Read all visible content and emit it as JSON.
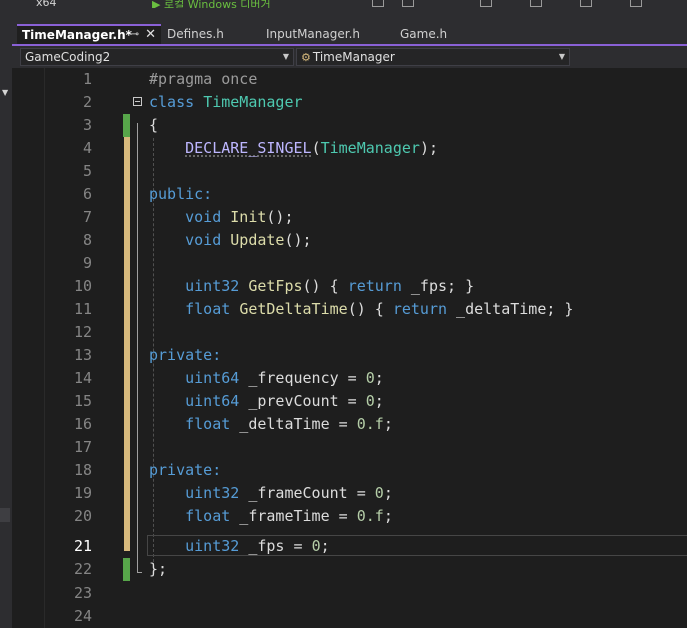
{
  "toolbar": {
    "platform_label": "x64",
    "run_label": "▶ 로컬 Windows 디버거"
  },
  "tabs": [
    {
      "label": "TimeManager.h*",
      "active": true
    },
    {
      "label": "Defines.h",
      "active": false
    },
    {
      "label": "InputManager.h",
      "active": false
    },
    {
      "label": "Game.h",
      "active": false
    }
  ],
  "tab_icons": {
    "pin": "⊸",
    "close": "✕"
  },
  "navigation": {
    "project": "GameCoding2",
    "scope": "TimeManager",
    "scope_icon": "class-icon"
  },
  "colors": {
    "accent": "#8a61d6",
    "keyword": "#569cd6",
    "type": "#4ec9b0",
    "function": "#dcdcaa",
    "number": "#b5cea8",
    "saved_change": "#57a64a",
    "unsaved_change": "#d7ba7d"
  },
  "editor": {
    "current_line": 21,
    "lines": [
      {
        "n": "1",
        "text": "#pragma once"
      },
      {
        "n": "2",
        "text": "class TimeManager"
      },
      {
        "n": "3",
        "text": "{"
      },
      {
        "n": "4",
        "text": "DECLARE_SINGEL(TimeManager);"
      },
      {
        "n": "5",
        "text": ""
      },
      {
        "n": "6",
        "text": "public:"
      },
      {
        "n": "7",
        "text": "void Init();"
      },
      {
        "n": "8",
        "text": "void Update();"
      },
      {
        "n": "9",
        "text": ""
      },
      {
        "n": "10",
        "text": "uint32 GetFps() { return _fps; }"
      },
      {
        "n": "11",
        "text": "float GetDeltaTime() { return _deltaTime; }"
      },
      {
        "n": "12",
        "text": ""
      },
      {
        "n": "13",
        "text": "private:"
      },
      {
        "n": "14",
        "text": "uint64 _frequency = 0;"
      },
      {
        "n": "15",
        "text": "uint64 _prevCount = 0;"
      },
      {
        "n": "16",
        "text": "float _deltaTime = 0.f;"
      },
      {
        "n": "17",
        "text": ""
      },
      {
        "n": "18",
        "text": "private:"
      },
      {
        "n": "19",
        "text": "uint32 _frameCount = 0;"
      },
      {
        "n": "20",
        "text": "float _frameTime = 0.f;"
      },
      {
        "n": "21",
        "text": "uint32 _fps = 0;"
      },
      {
        "n": "22",
        "text": "};"
      },
      {
        "n": "23",
        "text": ""
      },
      {
        "n": "24",
        "text": ""
      }
    ]
  }
}
